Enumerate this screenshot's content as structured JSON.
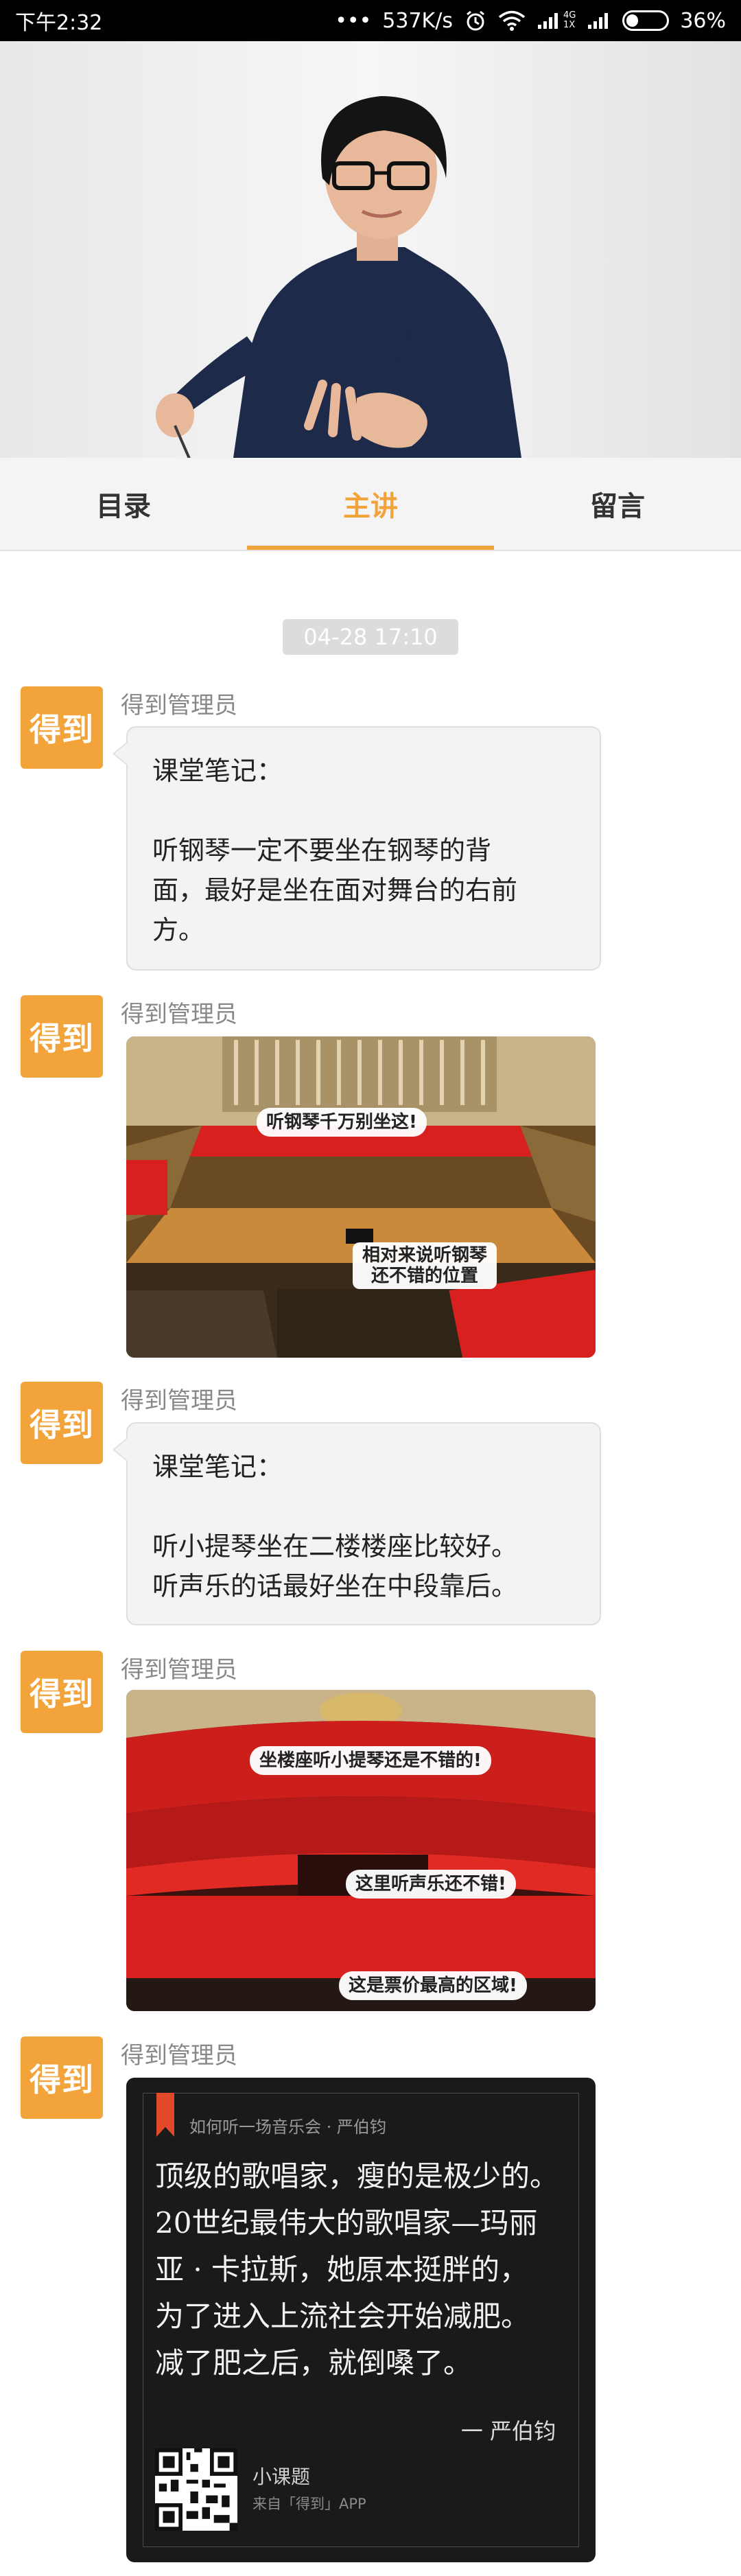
{
  "status_bar": {
    "time": "下午2:32",
    "dots": "•••",
    "network_speed": "537K/s",
    "net_label_top": "4G",
    "net_label_bottom": "1X",
    "battery_percent": "36%",
    "battery_level": 0.36
  },
  "tabs": [
    {
      "label": "目录",
      "active": false
    },
    {
      "label": "主讲",
      "active": true
    },
    {
      "label": "留言",
      "active": false
    }
  ],
  "chat": {
    "timestamp": "04-28 17:10",
    "avatar_text": "得到",
    "sender_name": "得到管理员",
    "messages": [
      {
        "type": "text",
        "lines": [
          "课堂笔记：",
          "",
          "听钢琴一定不要坐在钢琴的背",
          "面，最好是坐在面对舞台的右前",
          "方。"
        ]
      },
      {
        "type": "image",
        "callouts": [
          "听钢琴千万别坐这!",
          "相对来说听钢琴",
          "还不错的位置"
        ]
      },
      {
        "type": "text",
        "lines": [
          "课堂笔记：",
          "",
          "听小提琴坐在二楼楼座比较好。",
          "听声乐的话最好坐在中段靠后。"
        ]
      },
      {
        "type": "image",
        "callouts": [
          "坐楼座听小提琴还是不错的!",
          "这里听声乐还不错!",
          "这是票价最高的区域!"
        ]
      },
      {
        "type": "quote_card",
        "source": "如何听一场音乐会 · 严伯钧",
        "lines": [
          "顶级的歌唱家，瘦的是极少的。",
          "20世纪最伟大的歌唱家—玛丽",
          "亚 · 卡拉斯，她原本挺胖的，",
          "为了进入上流社会开始减肥。",
          "减了肥之后，就倒嗓了。"
        ],
        "author": "一 严伯钧",
        "app_name": "小课题",
        "app_sub": "来自「得到」APP"
      }
    ]
  },
  "colors": {
    "accent": "#f2a33a",
    "avatar_bg": "#f2a33a",
    "bubble_bg": "#f3f3f3",
    "seat_red": "#d8211f",
    "quote_ribbon": "#e2492a"
  }
}
